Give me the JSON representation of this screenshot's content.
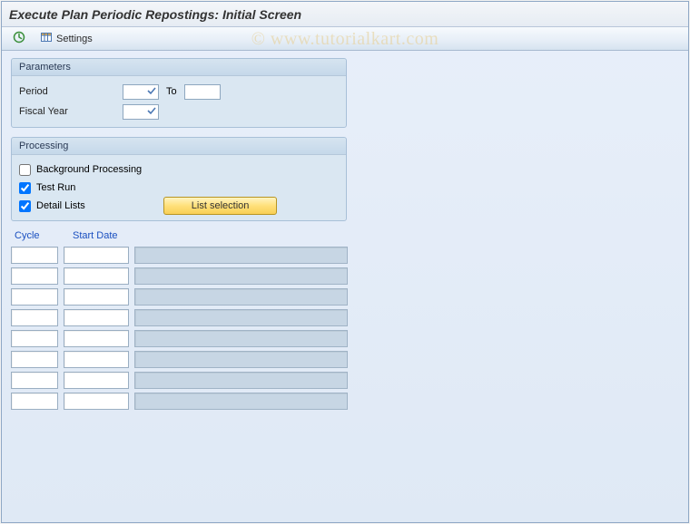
{
  "title": "Execute Plan Periodic Repostings: Initial Screen",
  "watermark": "© www.tutorialkart.com",
  "toolbar": {
    "execute_icon": "execute",
    "settings_label": "Settings"
  },
  "parameters": {
    "title": "Parameters",
    "period_label": "Period",
    "period_from": "",
    "to_label": "To",
    "period_to": "",
    "fiscal_year_label": "Fiscal Year",
    "fiscal_year": ""
  },
  "processing": {
    "title": "Processing",
    "background_label": "Background Processing",
    "background_checked": false,
    "testrun_label": "Test Run",
    "testrun_checked": true,
    "detaillists_label": "Detail Lists",
    "detaillists_checked": true,
    "list_selection_label": "List selection"
  },
  "table": {
    "cycle_header": "Cycle",
    "startdate_header": "Start Date",
    "rows": [
      {
        "cycle": "",
        "date": "",
        "desc": ""
      },
      {
        "cycle": "",
        "date": "",
        "desc": ""
      },
      {
        "cycle": "",
        "date": "",
        "desc": ""
      },
      {
        "cycle": "",
        "date": "",
        "desc": ""
      },
      {
        "cycle": "",
        "date": "",
        "desc": ""
      },
      {
        "cycle": "",
        "date": "",
        "desc": ""
      },
      {
        "cycle": "",
        "date": "",
        "desc": ""
      },
      {
        "cycle": "",
        "date": "",
        "desc": ""
      }
    ]
  }
}
